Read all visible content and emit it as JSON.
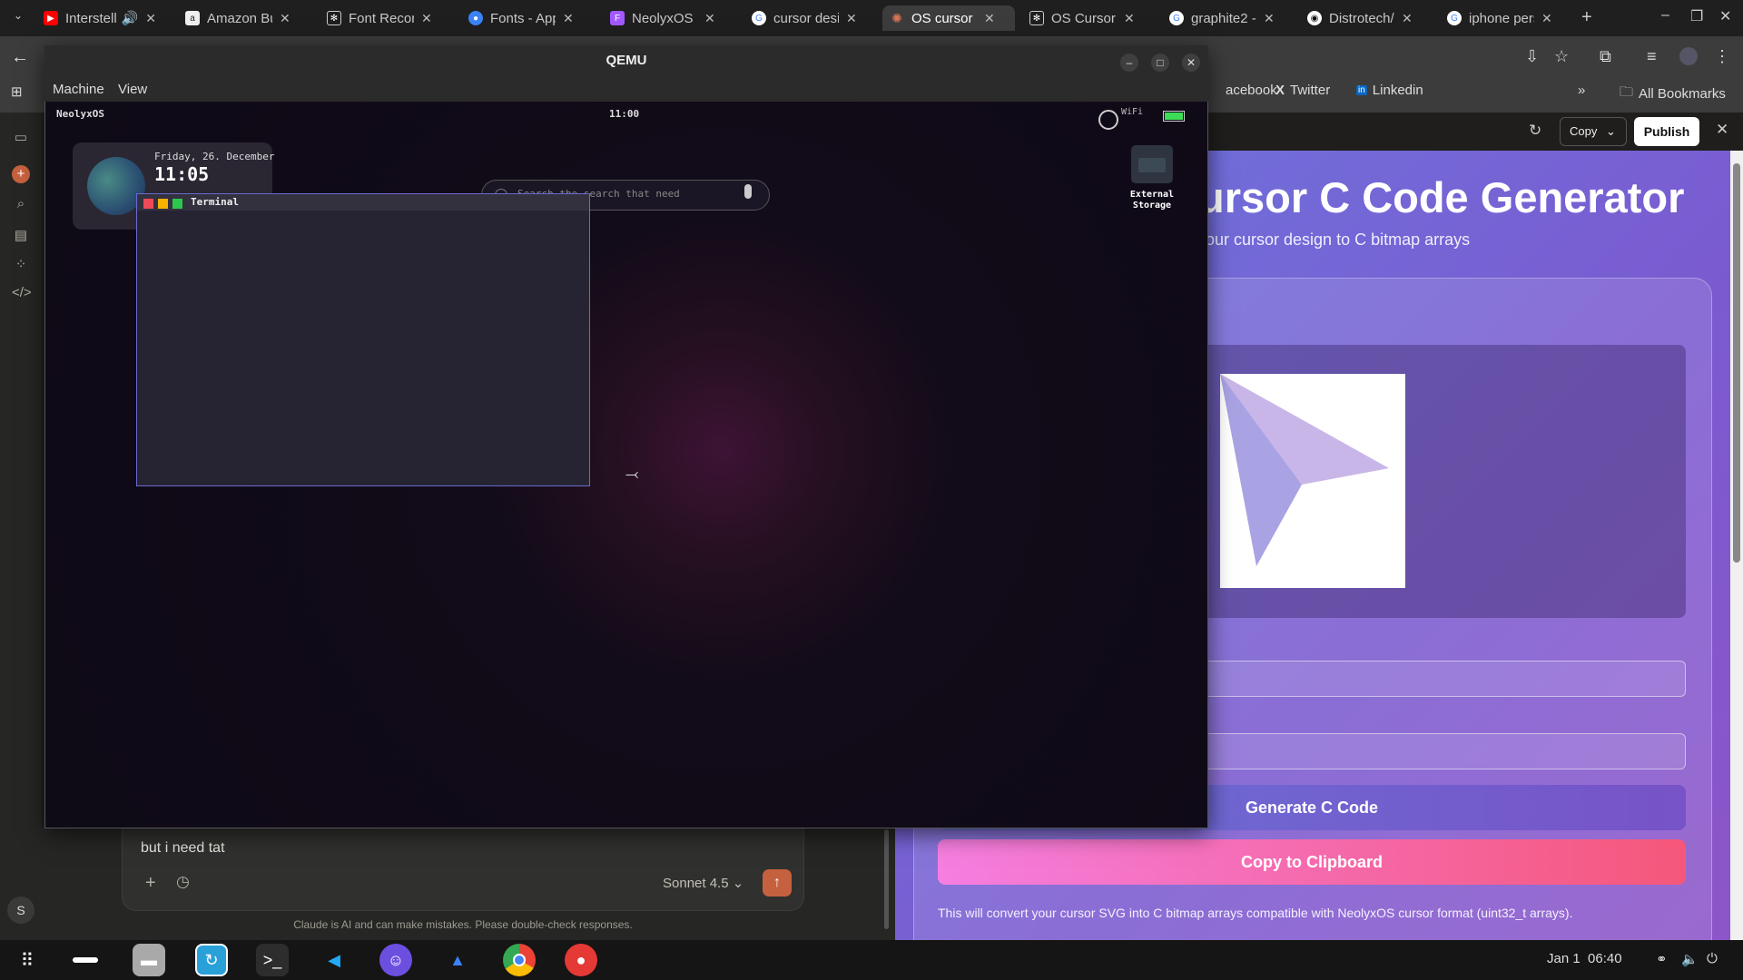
{
  "browser": {
    "tabs": [
      {
        "title": "Interstell",
        "favicon": "youtube-icon",
        "color": "#ff0000"
      },
      {
        "title": "Amazon Bus",
        "favicon": "amazon-icon",
        "color": "#222222"
      },
      {
        "title": "Font Recom",
        "favicon": "openai-icon",
        "color": "#444444"
      },
      {
        "title": "Fonts - Appl",
        "favicon": "globe-icon",
        "color": "#3b82f6"
      },
      {
        "title": "NeolyxOS - I",
        "favicon": "figma-icon",
        "color": "#a259ff"
      },
      {
        "title": "cursor desig",
        "favicon": "google-icon",
        "color": "#4285f4"
      },
      {
        "title": "OS cursor d",
        "favicon": "claude-icon",
        "color": "#d97757"
      },
      {
        "title": "OS Cursor S",
        "favicon": "openai-icon",
        "color": "#444444"
      },
      {
        "title": "graphite2 -",
        "favicon": "google-icon",
        "color": "#4285f4"
      },
      {
        "title": "Distrotech/",
        "favicon": "github-icon",
        "color": "#333333"
      },
      {
        "title": "iphone pers",
        "favicon": "google-icon",
        "color": "#4285f4"
      }
    ],
    "bookmarks": {
      "facebook": "acebook",
      "twitter": "Twitter",
      "linkedin": "Linkedin",
      "all": "All Bookmarks"
    }
  },
  "qemu": {
    "title": "QEMU",
    "menu": {
      "machine": "Machine",
      "view": "View"
    }
  },
  "guest": {
    "os_name": "NeolyxOS",
    "top_clock": "11:00",
    "wifi_label": "WiFi",
    "widget_date": "Friday, 26. December",
    "widget_time": "11:05",
    "search_placeholder": "Search the search that need",
    "external_storage": "External Storage",
    "terminal_title": "Terminal"
  },
  "artifact": {
    "toolbar": {
      "copy": "Copy",
      "publish": "Publish"
    },
    "title": "ursor C Code Generator",
    "subtitle": "our cursor design to C bitmap arrays",
    "generate_button": "Generate C Code",
    "copy_button": "Copy to Clipboard",
    "note": "This will convert your cursor SVG into C bitmap arrays compatible with NeolyxOS cursor format (uint32_t arrays)."
  },
  "chat": {
    "input_text": "but i need tat",
    "model": "Sonnet 4.5",
    "disclaimer": "Claude is AI and can make mistakes. Please double-check responses.",
    "user_initial": "S"
  },
  "taskbar": {
    "date": "Jan 1",
    "time": "06:40"
  }
}
